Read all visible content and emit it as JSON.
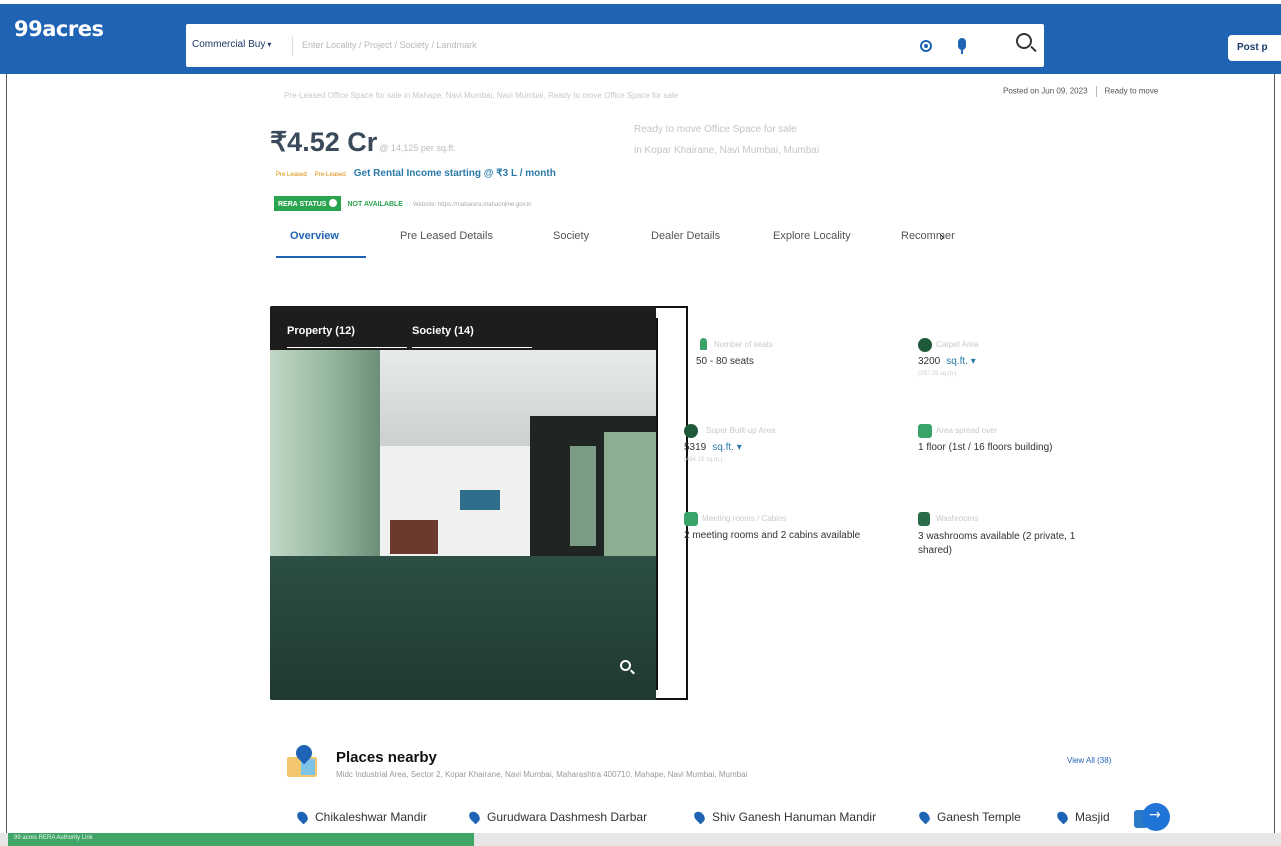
{
  "header": {
    "logo": "99acres",
    "search_type": "Commercial Buy",
    "search_placeholder": "Enter Locality / Project / Society / Landmark",
    "post_button": "Post p"
  },
  "listing": {
    "subline": "Pre-Leased Office Space for sale in Mahape, Navi Mumbai, Navi Mumbai. Ready to move Office Space for sale",
    "posted_on": "Posted on Jun 09, 2023",
    "status": "Ready to move",
    "price": "₹4.52 Cr",
    "price_per_sqft": "@ 14,125 per sq.ft.",
    "title": "Ready to move Office Space for sale",
    "address": "in Kopar Khairane, Navi Mumbai, Mumbai",
    "tags": [
      "Pre Leased",
      "Pre-Leased"
    ],
    "rental_income": "Get Rental Income starting @ ₹3 L / month",
    "rera_badge": "RERA STATUS",
    "rera_status": "NOT AVAILABLE",
    "rera_website": "Website: https://maharera.mahaonline.gov.in"
  },
  "tabs": [
    "Overview",
    "Pre Leased Details",
    "Society",
    "Dealer Details",
    "Explore Locality",
    "Recommer"
  ],
  "gallery": {
    "tabs": [
      "Property (12)",
      "Society (14)"
    ]
  },
  "specs": [
    {
      "icon": "seat-icon",
      "label": "Number of seats",
      "value": "50 - 80 seats"
    },
    {
      "icon": "carpet-area-icon",
      "label": "Carpet Area",
      "value": "3200",
      "unit": "sq.ft.",
      "sub": "(297.29 sq.m.)"
    },
    {
      "icon": "super-built-up-icon",
      "label": "Super Built-up Area",
      "value": "5319",
      "unit": "sq.ft.",
      "sub": "(494.15 sq.m.)"
    },
    {
      "icon": "floor-icon",
      "label": "Area spread over",
      "value": "1 floor (1st / 16 floors building)"
    },
    {
      "icon": "meeting-room-icon",
      "label": "Meeting rooms / Cabins",
      "value": "2 meeting rooms and 2 cabins available"
    },
    {
      "icon": "washroom-icon",
      "label": "Washrooms",
      "value": "3 washrooms available (2 private, 1 shared)"
    }
  ],
  "places": {
    "title": "Places nearby",
    "address": "Midc Industrial Area, Sector 2, Kopar Khairane, Navi Mumbai, Maharashtra 400710, Mahape, Navi Mumbai, Mumbai",
    "view_all": "View All (38)",
    "items": [
      "Chikaleshwar Mandir",
      "Gurudwara Dashmesh Darbar",
      "Shiv Ganesh Hanuman Mandir",
      "Ganesh Temple",
      "Masjid"
    ]
  },
  "footer": {
    "status_text": "99 acres RERA Authority Link"
  },
  "colors": {
    "brand_blue": "#1f63b4",
    "rera_green": "#2aa44f",
    "rental_blue": "#2a7aa8"
  }
}
